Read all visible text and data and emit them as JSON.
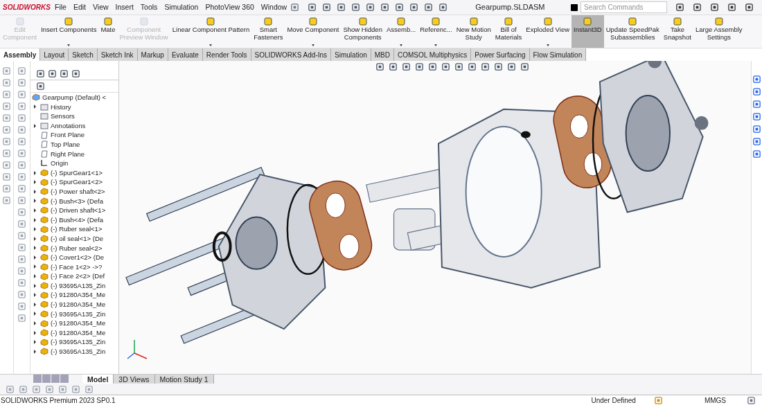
{
  "app": {
    "logo": "SOLIDWORKS",
    "menu": [
      "File",
      "Edit",
      "View",
      "Insert",
      "Tools",
      "Simulation",
      "PhotoView 360",
      "Window"
    ],
    "title": "Gearpump.SLDASM",
    "search": {
      "placeholder": "Search Commands"
    }
  },
  "ribbon": [
    {
      "lines": [
        "Edit",
        "Component"
      ],
      "disabled": true,
      "dropdown": false,
      "selected": false
    },
    {
      "lines": [
        "Insert Components"
      ],
      "disabled": false,
      "dropdown": true,
      "selected": false
    },
    {
      "lines": [
        "Mate"
      ],
      "disabled": false,
      "dropdown": false,
      "selected": false
    },
    {
      "lines": [
        "Component",
        "Preview Window"
      ],
      "disabled": true,
      "dropdown": false,
      "selected": false
    },
    {
      "lines": [
        "Linear Component Pattern"
      ],
      "disabled": false,
      "dropdown": true,
      "selected": false
    },
    {
      "lines": [
        "Smart",
        "Fasteners"
      ],
      "disabled": false,
      "dropdown": false,
      "selected": false
    },
    {
      "lines": [
        "Move Component"
      ],
      "disabled": false,
      "dropdown": true,
      "selected": false
    },
    {
      "lines": [
        "Show Hidden",
        "Components"
      ],
      "disabled": false,
      "dropdown": false,
      "selected": false
    },
    {
      "lines": [
        "Assemb..."
      ],
      "disabled": false,
      "dropdown": true,
      "selected": false
    },
    {
      "lines": [
        "Referenc..."
      ],
      "disabled": false,
      "dropdown": true,
      "selected": false
    },
    {
      "lines": [
        "New Motion",
        "Study"
      ],
      "disabled": false,
      "dropdown": false,
      "selected": false
    },
    {
      "lines": [
        "Bill of",
        "Materials"
      ],
      "disabled": false,
      "dropdown": false,
      "selected": false
    },
    {
      "lines": [
        "Exploded View"
      ],
      "disabled": false,
      "dropdown": true,
      "selected": false
    },
    {
      "lines": [
        "Instant3D"
      ],
      "disabled": false,
      "dropdown": false,
      "selected": true
    },
    {
      "lines": [
        "Update SpeedPak",
        "Subassemblies"
      ],
      "disabled": false,
      "dropdown": false,
      "selected": false
    },
    {
      "lines": [
        "Take",
        "Snapshot"
      ],
      "disabled": false,
      "dropdown": false,
      "selected": false
    },
    {
      "lines": [
        "Large Assembly",
        "Settings"
      ],
      "disabled": false,
      "dropdown": false,
      "selected": false
    }
  ],
  "tabs": [
    {
      "label": "Assembly",
      "selected": true
    },
    {
      "label": "Layout",
      "selected": false
    },
    {
      "label": "Sketch",
      "selected": false
    },
    {
      "label": "Sketch Ink",
      "selected": false
    },
    {
      "label": "Markup",
      "selected": false
    },
    {
      "label": "Evaluate",
      "selected": false
    },
    {
      "label": "Render Tools",
      "selected": false
    },
    {
      "label": "SOLIDWORKS Add-Ins",
      "selected": false
    },
    {
      "label": "Simulation",
      "selected": false
    },
    {
      "label": "MBD",
      "selected": false
    },
    {
      "label": "COMSOL Multiphysics",
      "selected": false
    },
    {
      "label": "Power Surfacing",
      "selected": false
    },
    {
      "label": "Flow Simulation",
      "selected": false
    }
  ],
  "tree": [
    {
      "label": "Gearpump (Default) <",
      "kind": "root",
      "expandable": false
    },
    {
      "label": "History",
      "kind": "folder",
      "expandable": true
    },
    {
      "label": "Sensors",
      "kind": "folder",
      "expandable": false
    },
    {
      "label": "Annotations",
      "kind": "folder",
      "expandable": true
    },
    {
      "label": "Front Plane",
      "kind": "plane",
      "expandable": false
    },
    {
      "label": "Top Plane",
      "kind": "plane",
      "expandable": false
    },
    {
      "label": "Right Plane",
      "kind": "plane",
      "expandable": false
    },
    {
      "label": "Origin",
      "kind": "origin",
      "expandable": false
    },
    {
      "label": "(-) SpurGear1<1>",
      "kind": "part",
      "expandable": true
    },
    {
      "label": "(-) SpurGear1<2>",
      "kind": "part",
      "expandable": true
    },
    {
      "label": "(-) Power shaft<2>",
      "kind": "part",
      "expandable": true
    },
    {
      "label": "(-) Bush<3> (Defa",
      "kind": "part",
      "expandable": true
    },
    {
      "label": "(-) Driven shaft<1>",
      "kind": "part",
      "expandable": true
    },
    {
      "label": "(-) Bush<4> (Defa",
      "kind": "part",
      "expandable": true
    },
    {
      "label": "(-) Ruber seal<1>",
      "kind": "part",
      "expandable": true
    },
    {
      "label": "(-) oil seal<1> (De",
      "kind": "part",
      "expandable": true
    },
    {
      "label": "(-) Ruber seal<2>",
      "kind": "part",
      "expandable": true
    },
    {
      "label": "(-) Cover1<2> (De",
      "kind": "part",
      "expandable": true
    },
    {
      "label": "(-) Face 1<2> ->?",
      "kind": "part",
      "expandable": true
    },
    {
      "label": "(-) Face 2<2> (Def",
      "kind": "part",
      "expandable": true
    },
    {
      "label": "(-) 93695A135_Zin",
      "kind": "part",
      "expandable": true
    },
    {
      "label": "(-) 91280A354_Me",
      "kind": "part",
      "expandable": true
    },
    {
      "label": "(-) 91280A354_Me",
      "kind": "part",
      "expandable": true
    },
    {
      "label": "(-) 93695A135_Zin",
      "kind": "part",
      "expandable": true
    },
    {
      "label": "(-) 91280A354_Me",
      "kind": "part",
      "expandable": true
    },
    {
      "label": "(-) 91280A354_Me",
      "kind": "part",
      "expandable": true
    },
    {
      "label": "(-) 93695A135_Zin",
      "kind": "part",
      "expandable": true
    },
    {
      "label": "(-) 93695A135_Zin",
      "kind": "part",
      "expandable": true
    }
  ],
  "bottom_tabs": [
    {
      "label": "Model",
      "selected": true
    },
    {
      "label": "3D Views",
      "selected": false
    },
    {
      "label": "Motion Study 1",
      "selected": false
    }
  ],
  "status_bar": {
    "product": "SOLIDWORKS Premium 2023 SP0.1",
    "state": "Under Defined",
    "units": "MMGS"
  }
}
